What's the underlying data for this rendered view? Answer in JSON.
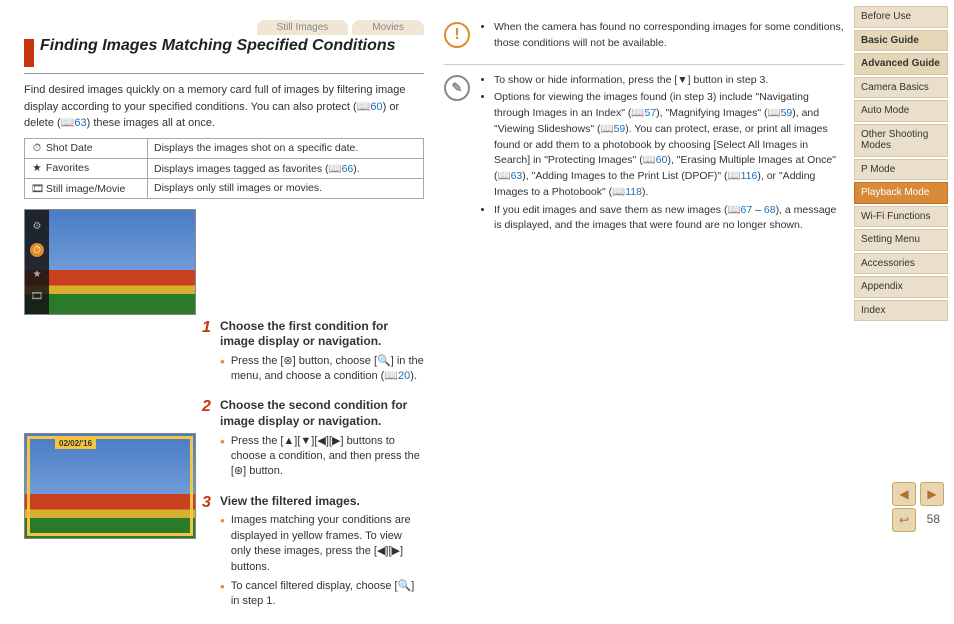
{
  "tabs": {
    "still": "Still Images",
    "movies": "Movies"
  },
  "title": "Finding Images Matching Specified Conditions",
  "intro": {
    "p1a": "Find desired images quickly on a memory card full of images by filtering image display according to your specified conditions. You can also protect (",
    "ref1": "60",
    "p1b": ") or delete (",
    "ref2": "63",
    "p1c": ") these images all at once."
  },
  "table": [
    {
      "icon": "⏱",
      "label": "Shot Date",
      "desc": "Displays the images shot on a specific date."
    },
    {
      "icon": "★",
      "label": "Favorites",
      "descA": "Displays images tagged as favorites (",
      "ref": "66",
      "descB": ")."
    },
    {
      "icon": "🎞",
      "label": "Still image/Movie",
      "desc": "Displays only still images or movies."
    }
  ],
  "date_badge": "02/02/'16",
  "steps": [
    {
      "n": "1",
      "title": "Choose the first condition for image display or navigation.",
      "bullets": [
        {
          "a": "Press the [",
          "b": "] button, choose [",
          "c": "] in the menu, and choose a condition (",
          "ref": "20",
          "d": ")."
        }
      ]
    },
    {
      "n": "2",
      "title": "Choose the second condition for image display or navigation.",
      "bullets": [
        {
          "a": "Press the [▲][▼][◀][▶] buttons to choose a condition, and then press the [",
          "b": "] button."
        }
      ]
    },
    {
      "n": "3",
      "title": "View the filtered images.",
      "bullets": [
        {
          "t": "Images matching your conditions are displayed in yellow frames. To view only these images, press the [◀][▶] buttons."
        },
        {
          "a": "To cancel filtered display, choose [",
          "b": "] in step 1."
        }
      ]
    }
  ],
  "warning": "When the camera has found no corresponding images for some conditions, those conditions will not be available.",
  "notes": [
    "To show or hide information, press the [▼] button in step 3.",
    {
      "a": "Options for viewing the images found (in step 3) include \"Navigating through Images in an Index\" (",
      "r1": "57",
      "b": "), \"Magnifying Images\" (",
      "r2": "59",
      "c": "), and \"Viewing Slideshows\" (",
      "r3": "59",
      "d": "). You can protect, erase, or print all images found or add them to a photobook by choosing [Select All Images in Search] in \"Protecting Images\" (",
      "r4": "60",
      "e": "), \"Erasing Multiple Images at Once\" (",
      "r5": "63",
      "f": "), \"Adding Images to the Print List (DPOF)\" (",
      "r6": "116",
      "g": "), or \"Adding Images to a Photobook\" (",
      "r7": "118",
      "h": ")."
    },
    {
      "a": "If you edit images and save them as new images (",
      "r1": "67",
      "dash": " – ",
      "r2": "68",
      "b": "), a message is displayed, and the images that were found are no longer shown."
    }
  ],
  "sidebar": [
    {
      "t": "Before Use",
      "b": false
    },
    {
      "t": "Basic Guide",
      "b": true
    },
    {
      "t": "Advanced Guide",
      "b": true
    },
    {
      "t": "Camera Basics",
      "b": false
    },
    {
      "t": "Auto Mode",
      "b": false
    },
    {
      "t": "Other Shooting Modes",
      "b": false
    },
    {
      "t": "P Mode",
      "b": false
    },
    {
      "t": "Playback Mode",
      "b": false,
      "active": true
    },
    {
      "t": "Wi-Fi Functions",
      "b": false
    },
    {
      "t": "Setting Menu",
      "b": false
    },
    {
      "t": "Accessories",
      "b": false
    },
    {
      "t": "Appendix",
      "b": false
    },
    {
      "t": "Index",
      "b": false
    }
  ],
  "page_number": "58",
  "nav": {
    "prev": "◀",
    "next": "▶",
    "return": "↩"
  }
}
